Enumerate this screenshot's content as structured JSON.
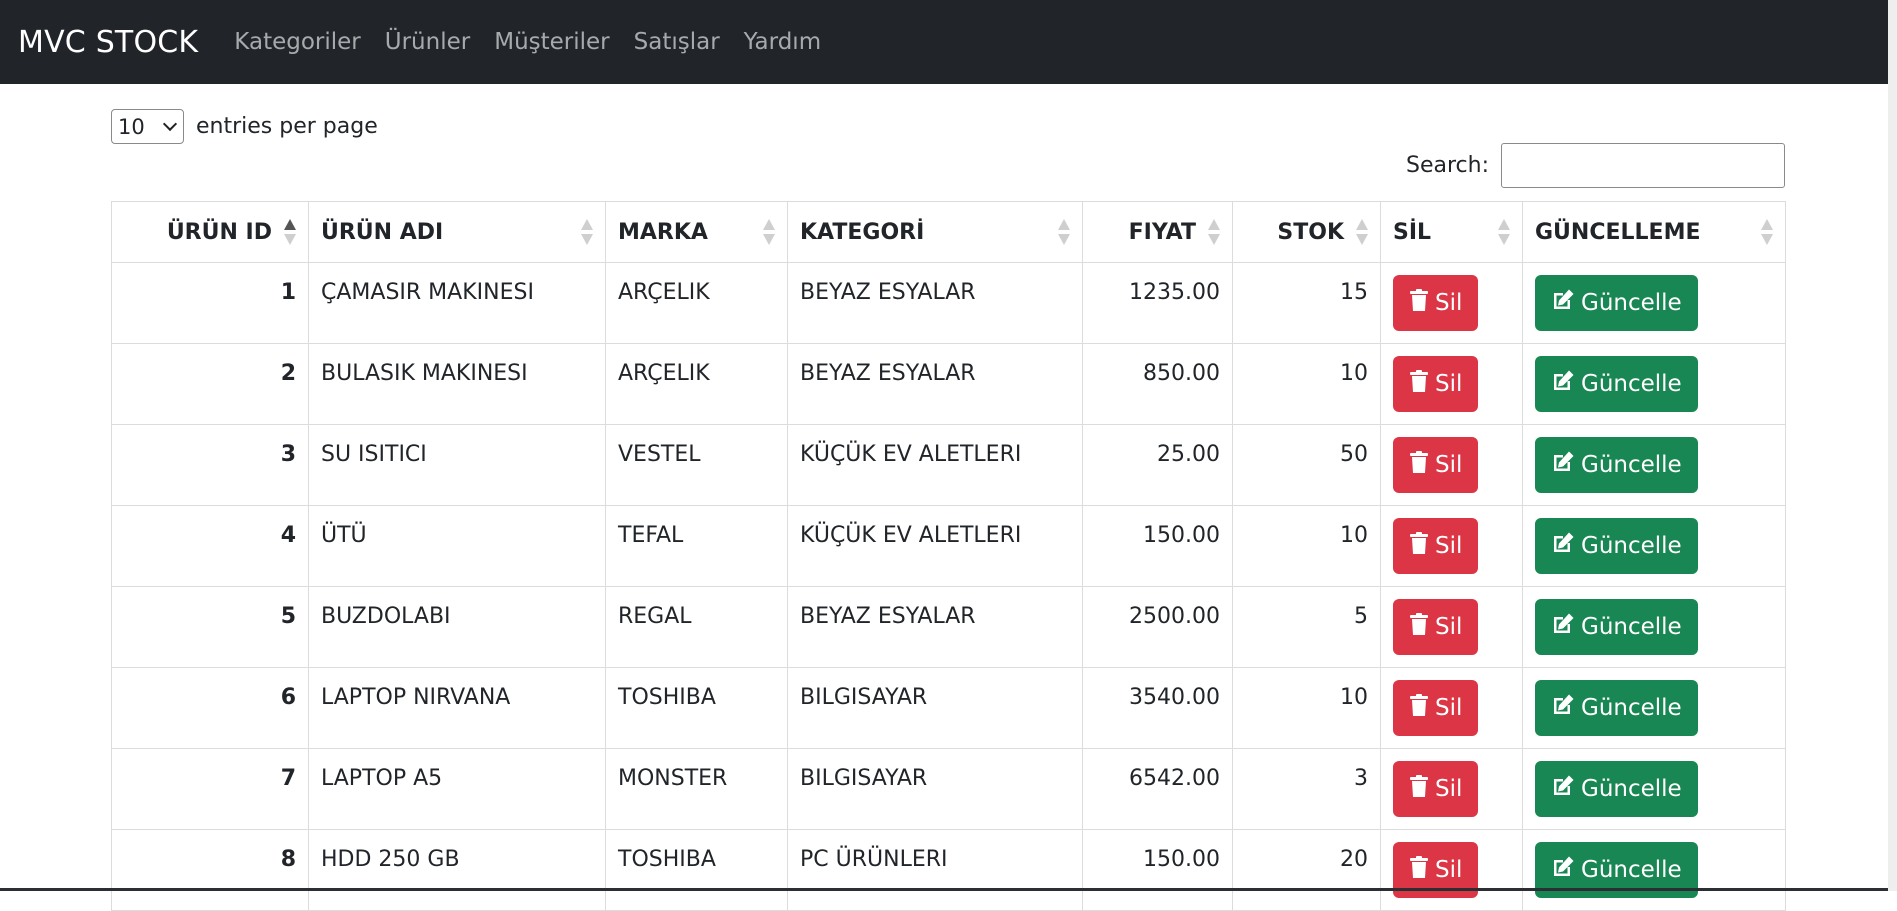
{
  "navbar": {
    "brand": "MVC STOCK",
    "links": [
      "Kategoriler",
      "Ürünler",
      "Müşteriler",
      "Satışlar",
      "Yardım"
    ]
  },
  "controls": {
    "entries_value": "10",
    "entries_label": "entries per page",
    "search_label": "Search:",
    "search_value": ""
  },
  "table": {
    "headers": [
      "ÜRÜN ID",
      "ÜRÜN ADI",
      "MARKA",
      "KATEGORİ",
      "FIYAT",
      "STOK",
      "SİL",
      "GÜNCELLEME"
    ],
    "sorted_column": "ÜRÜN ID",
    "rows": [
      {
        "id": "1",
        "name": "ÇAMASIR MAKINESI",
        "brand": "ARÇELIK",
        "category": "BEYAZ ESYALAR",
        "price": "1235.00",
        "stock": "15"
      },
      {
        "id": "2",
        "name": "BULASIK MAKINESI",
        "brand": "ARÇELIK",
        "category": "BEYAZ ESYALAR",
        "price": "850.00",
        "stock": "10"
      },
      {
        "id": "3",
        "name": "SU ISITICI",
        "brand": "VESTEL",
        "category": "KÜÇÜK EV ALETLERI",
        "price": "25.00",
        "stock": "50"
      },
      {
        "id": "4",
        "name": "ÜTÜ",
        "brand": "TEFAL",
        "category": "KÜÇÜK EV ALETLERI",
        "price": "150.00",
        "stock": "10"
      },
      {
        "id": "5",
        "name": "BUZDOLABI",
        "brand": "REGAL",
        "category": "BEYAZ ESYALAR",
        "price": "2500.00",
        "stock": "5"
      },
      {
        "id": "6",
        "name": "LAPTOP NIRVANA",
        "brand": "TOSHIBA",
        "category": "BILGISAYAR",
        "price": "3540.00",
        "stock": "10"
      },
      {
        "id": "7",
        "name": "LAPTOP A5",
        "brand": "MONSTER",
        "category": "BILGISAYAR",
        "price": "6542.00",
        "stock": "3"
      },
      {
        "id": "8",
        "name": "HDD 250 GB",
        "brand": "TOSHIBA",
        "category": "PC ÜRÜNLERI",
        "price": "150.00",
        "stock": "20"
      }
    ]
  },
  "buttons": {
    "delete_label": "Sil",
    "delete_icon": "trash-icon",
    "update_label": "Güncelle",
    "update_icon": "edit-icon"
  },
  "colors": {
    "navbar_bg": "#212529",
    "danger": "#dc3545",
    "success": "#198754"
  }
}
